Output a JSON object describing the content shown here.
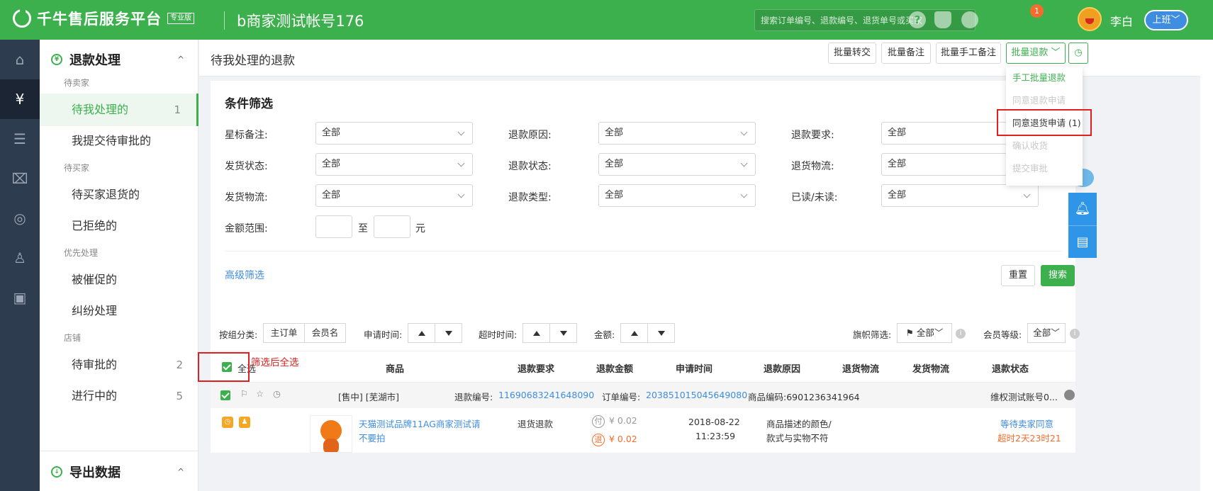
{
  "header": {
    "platform_name": "千牛售后服务平台",
    "edition_badge": "专业版",
    "account_name": "b商家测试帐号176",
    "search_placeholder": "搜索订单编号、退款编号、退货单号或买家",
    "help_glyph": "?",
    "notification_count": "1",
    "user_name": "李白",
    "duty_button": "上班﹀"
  },
  "sidebar": {
    "section_title": "退款处理",
    "section_icon_glyph": "¥",
    "collapse_glyph": "^",
    "groups": [
      {
        "label": "待卖家"
      },
      {
        "label": "待买家"
      },
      {
        "label": "优先处理"
      },
      {
        "label": "店铺"
      }
    ],
    "items": [
      {
        "label": "待我处理的",
        "count": "1"
      },
      {
        "label": "我提交待审批的",
        "count": ""
      },
      {
        "label": "待买家退货的",
        "count": ""
      },
      {
        "label": "已拒绝的",
        "count": ""
      },
      {
        "label": "被催促的",
        "count": ""
      },
      {
        "label": "纠纷处理",
        "count": ""
      },
      {
        "label": "待审批的",
        "count": "2"
      },
      {
        "label": "进行中的",
        "count": "5"
      }
    ],
    "export_title": "导出数据"
  },
  "iconbar": {
    "icons": [
      "home-icon",
      "refund-icon",
      "list-icon",
      "ticket-icon",
      "compass-icon",
      "users-icon",
      "calendar-icon"
    ]
  },
  "page": {
    "title": "待我处理的退款",
    "actions": {
      "batch_transfer": "批量转交",
      "batch_note": "批量备注",
      "batch_manual_note": "批量手工备注",
      "batch_refund": "批量退款 ﹀",
      "history_glyph": "◷"
    },
    "refund_menu": [
      {
        "label": "手工批量退款",
        "state": "enabled"
      },
      {
        "label": "同意退款申请",
        "state": "disabled"
      },
      {
        "label": "同意退货申请 (1)",
        "state": "normal"
      },
      {
        "label": "确认收货",
        "state": "disabled"
      },
      {
        "label": "提交审批",
        "state": "disabled"
      }
    ]
  },
  "filters": {
    "title": "条件筛选",
    "fields": [
      {
        "label": "星标备注:",
        "value": "全部"
      },
      {
        "label": "退款原因:",
        "value": "全部"
      },
      {
        "label": "退款要求:",
        "value": "全部"
      },
      {
        "label": "发货状态:",
        "value": "全部"
      },
      {
        "label": "退款状态:",
        "value": "全部"
      },
      {
        "label": "退货物流:",
        "value": "全部"
      },
      {
        "label": "发货物流:",
        "value": "全部"
      },
      {
        "label": "退款类型:",
        "value": "全部"
      },
      {
        "label": "已读/未读:",
        "value": "全部"
      }
    ],
    "amount_label": "金额范围:",
    "amount_to": "至",
    "amount_unit": "元",
    "advanced": "高级筛选",
    "reset": "重置",
    "search": "搜索"
  },
  "list": {
    "group_by_label": "按组分类:",
    "group_main_order": "主订单",
    "group_member": "会员名",
    "apply_time_label": "申请时间:",
    "timeout_label": "超时时间:",
    "amount_label": "金额:",
    "flag_filter_label": "旗帜筛选:",
    "flag_filter_value": "全部﹀",
    "member_level_label": "会员等级:",
    "member_level_value": "全部﹀",
    "select_all": "全选",
    "annotation": "筛选后全选",
    "columns": [
      "商品",
      "退款要求",
      "退款金额",
      "申请时间",
      "退款原因",
      "退货物流",
      "发货物流",
      "退款状态"
    ],
    "group_row": {
      "shop_tag": "[售中] [芜湖市]",
      "refund_no_label": "退款编号:",
      "refund_no": "11690683241648090",
      "order_no_label": "订单编号:",
      "order_no": "203851015045649080",
      "product_code": "商品编码:6901236341964",
      "account": "维权测试账号0..."
    },
    "order": {
      "product_title_1": "天猫测试品牌11AG商家测试请",
      "product_title_2": "不要拍",
      "refund_request": "退货退款",
      "pay_tag": "付",
      "pay_amount": "¥ 0.02",
      "refund_tag": "退",
      "refund_amount": "¥ 0.02",
      "apply_date": "2018-08-22",
      "apply_time": "11:23:59",
      "reason_1": "商品描述的颜色/",
      "reason_2": "款式与实物不符",
      "status": "等待卖家同意",
      "timeout": "超时2天23时21"
    }
  },
  "colors": {
    "brand_green": "#3db04e",
    "sidebar_dark": "#2e3c4f",
    "link_blue": "#3f8de0",
    "warn_orange": "#f56c2e",
    "annot_red": "#e02020"
  }
}
